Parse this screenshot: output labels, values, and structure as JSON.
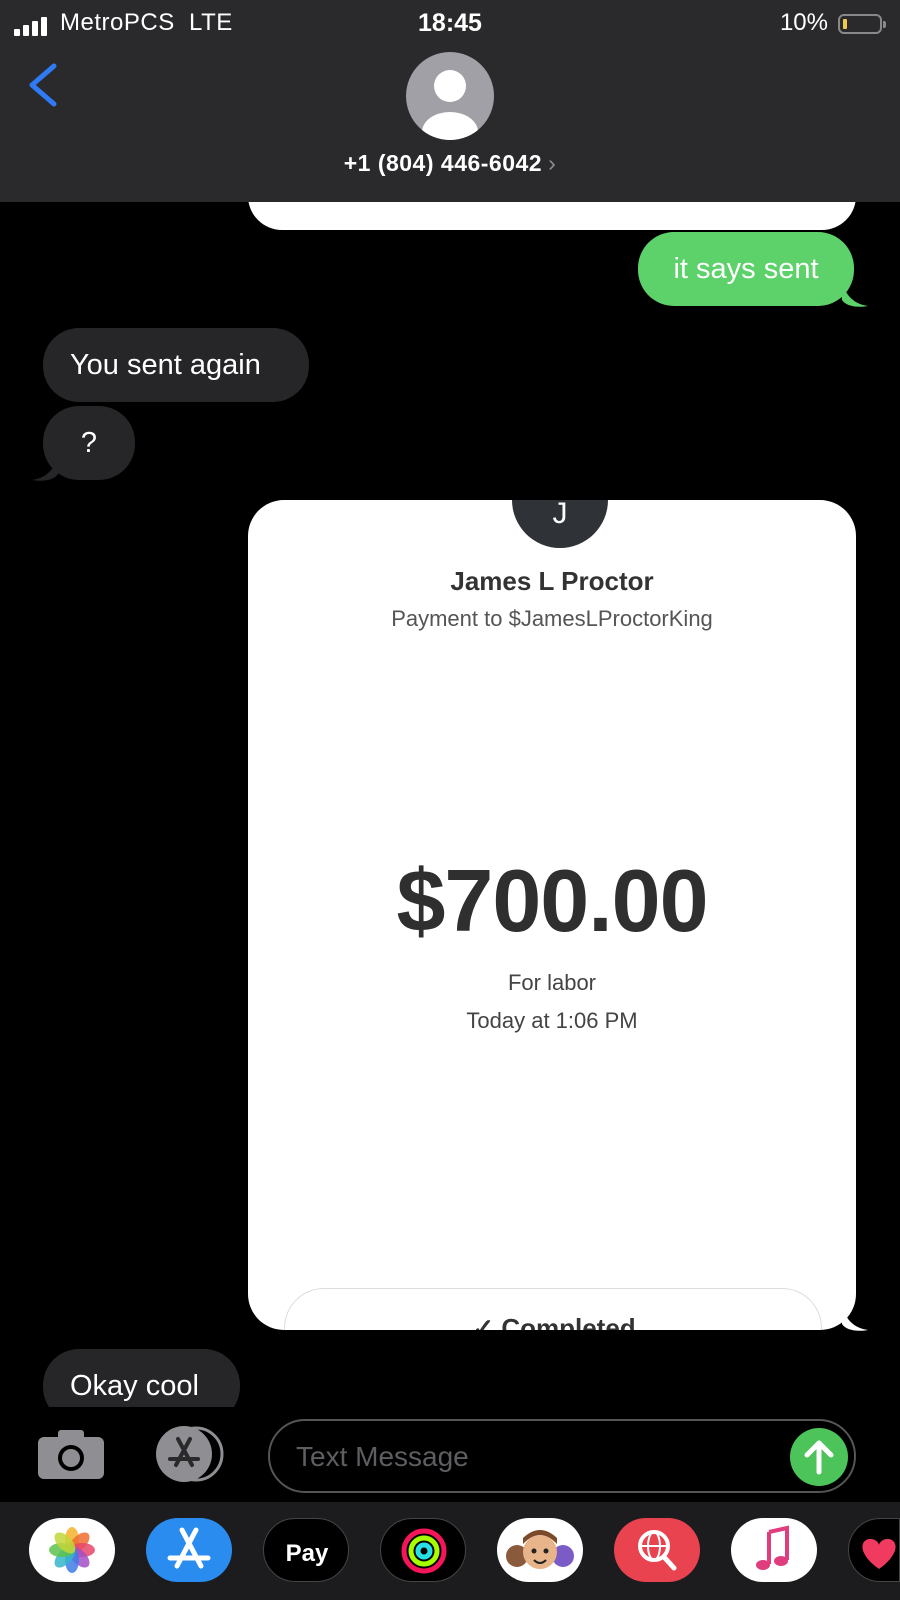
{
  "status_bar": {
    "carrier": "MetroPCS",
    "network": "LTE",
    "time": "18:45",
    "battery": "10%",
    "battery_level": 0.1
  },
  "header": {
    "contact": "+1 (804) 446-6042",
    "chevron": "›"
  },
  "messages": {
    "sent_1": "it says sent",
    "received_1": "You sent again",
    "received_2": "?",
    "received_3": "Okay cool"
  },
  "payment_card": {
    "avatar_initial": "J",
    "payee": "James L Proctor",
    "payment_to": "Payment to $JamesLProctorKing",
    "amount": "$700.00",
    "memo": "For labor",
    "time": "Today at 1:06 PM",
    "status": "✓ Completed"
  },
  "input": {
    "placeholder": "Text Message"
  },
  "colors": {
    "sent_bubble": "#5dd16a",
    "received_bubble": "#262628",
    "header_bg": "#2a2a2c",
    "accent_blue": "#2f7bf6"
  },
  "icons": {
    "back": "chevron-left-icon",
    "camera": "camera-icon",
    "apps": "app-store-icon",
    "send": "arrow-up-icon"
  },
  "app_drawer": [
    "Photos",
    "App Store",
    "Apple Pay",
    "Activity",
    "Memoji",
    "Search Images",
    "Music",
    "Hearts"
  ]
}
